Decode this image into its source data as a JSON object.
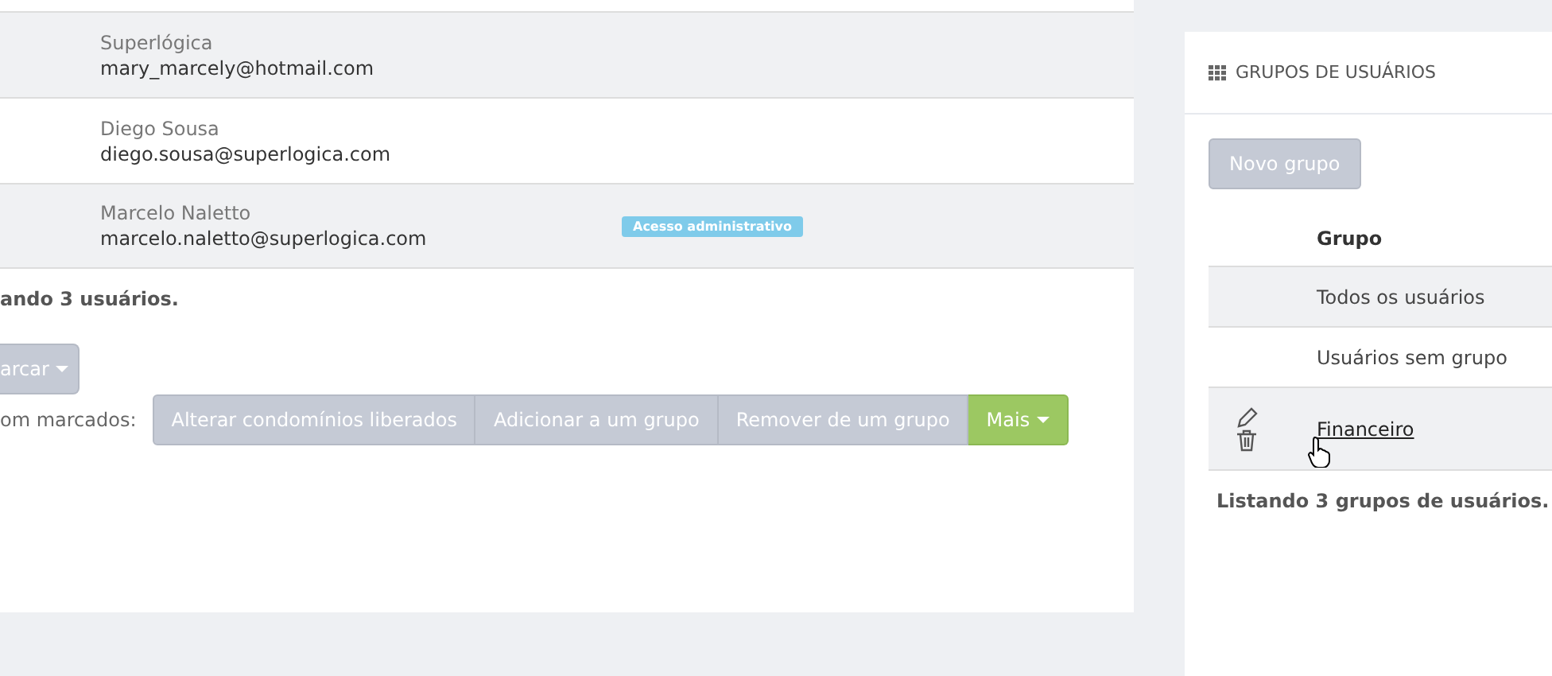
{
  "users": [
    {
      "name": "Superlógica",
      "email": "mary_marcely@hotmail.com"
    },
    {
      "name": "Diego Sousa",
      "email": "diego.sousa@superlogica.com"
    },
    {
      "name": "Marcelo Naletto",
      "email": "marcelo.naletto@superlogica.com",
      "badge": "Acesso administrativo"
    }
  ],
  "users_footer": "ando 3 usuários.",
  "mark_button": "arcar",
  "bulk_label": "om marcados:",
  "bulk_actions": [
    {
      "label": "Alterar condomínios liberados",
      "kind": "plain"
    },
    {
      "label": "Adicionar a um grupo",
      "kind": "plain"
    },
    {
      "label": "Remover de um grupo",
      "kind": "plain"
    },
    {
      "label": "Mais",
      "kind": "dropdown"
    }
  ],
  "groups_panel": {
    "title": "GRUPOS DE USUÁRIOS",
    "new_button": "Novo grupo",
    "column": "Grupo",
    "rows": [
      {
        "label": "Todos os usuários",
        "kind": "fixed"
      },
      {
        "label": "Usuários sem grupo",
        "kind": "fixed"
      },
      {
        "label": "Financeiro",
        "kind": "link",
        "hovered": true
      }
    ],
    "footer": "Listando 3 grupos de usuários."
  }
}
